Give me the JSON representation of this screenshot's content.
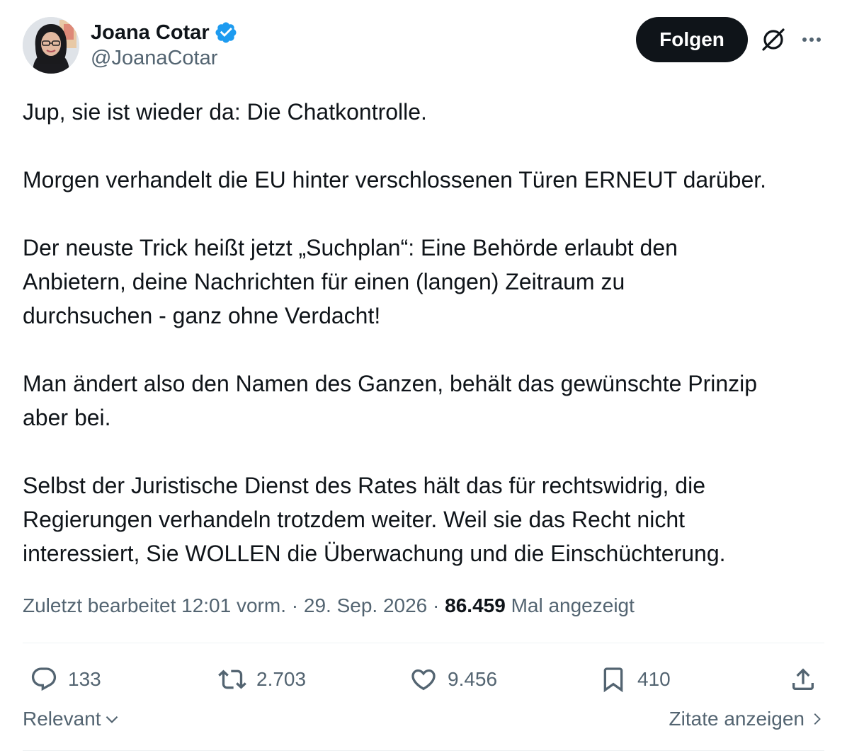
{
  "author": {
    "display_name": "Joana Cotar",
    "handle": "@JoanaCotar",
    "verified_icon": "verified-badge-icon",
    "brand_color": "#1d9bf0"
  },
  "header": {
    "follow_label": "Folgen",
    "grok_icon": "grok-icon",
    "more_icon": "more-icon"
  },
  "body": {
    "paragraphs": [
      "Jup, sie ist wieder da: Die Chatkontrolle.",
      "Morgen verhandelt die EU hinter verschlossenen Türen ERNEUT darüber.",
      "Der neuste Trick heißt jetzt „Suchplan“: Eine Behörde erlaubt den\nAnbietern, deine Nachrichten für einen (langen) Zeitraum zu\ndurchsuchen - ganz ohne Verdacht!",
      "Man ändert also den Namen des Ganzen, behält das gewünschte Prinzip\naber bei.",
      "Selbst der Juristische Dienst des Rates hält das für rechtswidrig, die\nRegierungen verhandeln trotzdem weiter. Weil sie das Recht nicht\ninteressiert, Sie WOLLEN die Überwachung und die Einschüchterung."
    ]
  },
  "meta": {
    "edited_label": "Zuletzt bearbeitet 12:01 vorm.",
    "separator": "·",
    "date": "29. Sep. 2026",
    "views_count": "86.459",
    "views_label": "Mal angezeigt"
  },
  "actions": {
    "replies": "133",
    "reposts": "2.703",
    "likes": "9.456",
    "bookmarks": "410"
  },
  "footer": {
    "sort_label": "Relevant",
    "quotes_label": "Zitate anzeigen"
  }
}
